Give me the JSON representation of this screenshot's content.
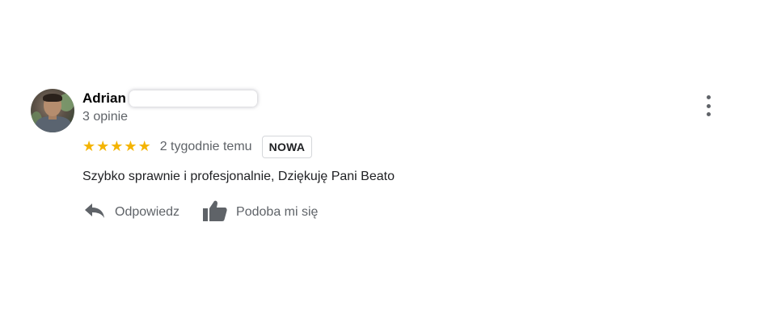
{
  "review": {
    "reviewer_name": "Adrian",
    "reviewer_meta": "3 opinie",
    "rating": 5,
    "rating_max": 5,
    "time_ago": "2 tygodnie temu",
    "badge": "NOWA",
    "text": "Szybko sprawnie i profesjonalnie, Dziękuję Pani Beato",
    "colors": {
      "star": "#f4b400",
      "muted": "#5f6368",
      "text": "#202124"
    }
  },
  "actions": {
    "reply_label": "Odpowiedz",
    "like_label": "Podoba mi się",
    "reply_icon": "reply-icon",
    "like_icon": "thumbs-up-icon"
  },
  "menu": {
    "icon": "more-vert-icon"
  }
}
